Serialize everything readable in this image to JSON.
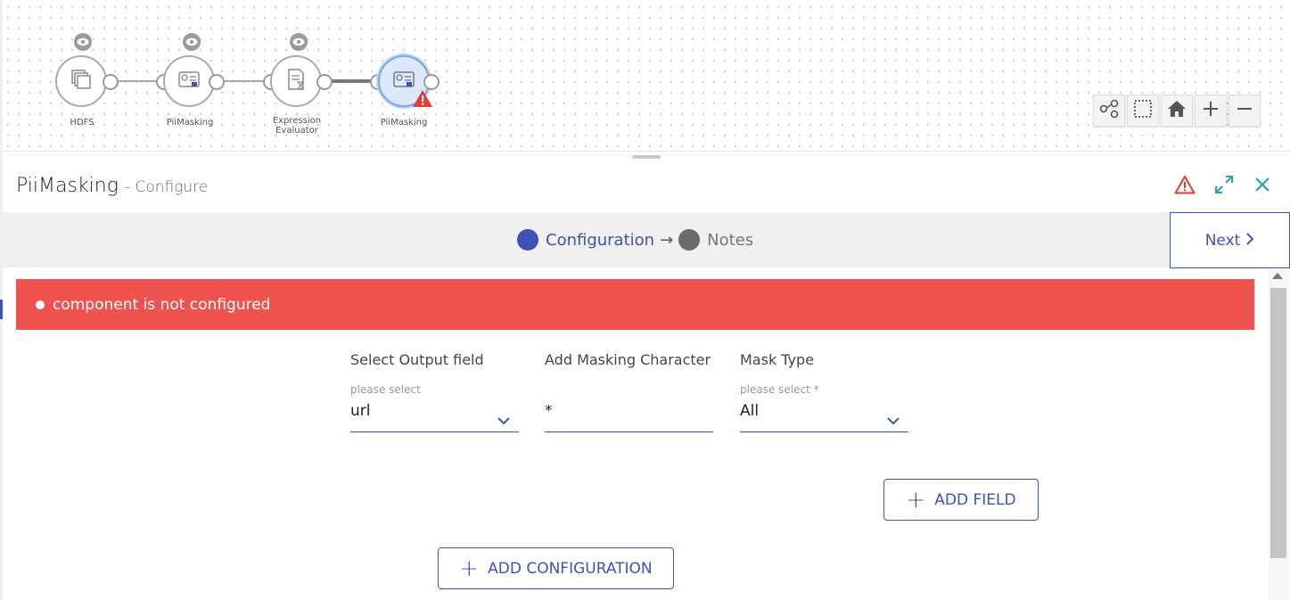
{
  "pipeline": {
    "nodes": [
      {
        "label": "HDFS",
        "icon": "hdfs-icon"
      },
      {
        "label": "PiiMasking",
        "icon": "pii-masking-icon"
      },
      {
        "label": "Expression Evaluator",
        "icon": "expression-evaluator-icon"
      },
      {
        "label": "PiiMasking",
        "icon": "pii-masking-icon",
        "active": true,
        "warning": true
      }
    ]
  },
  "canvas_toolbar": [
    "auto-layout-icon",
    "select-area-icon",
    "home-icon",
    "zoom-in-icon",
    "zoom-out-icon"
  ],
  "panel": {
    "title": "PiiMasking",
    "subtitle": "- Configure"
  },
  "steps": {
    "current": "Configuration",
    "arrow": "→",
    "next": "Notes",
    "current_color": "#3f51b5",
    "next_color": "#6b6b6b"
  },
  "next_button": {
    "label": "Next"
  },
  "error": {
    "message": "component is not configured",
    "color": "#ef5350"
  },
  "fields": {
    "output": {
      "label": "Select Output field",
      "hint": "please select",
      "value": "url"
    },
    "masking": {
      "label": "Add Masking Character",
      "value": "*"
    },
    "mask_type": {
      "label": "Mask Type",
      "hint": "please select *",
      "value": "All"
    }
  },
  "buttons": {
    "add_field": "ADD FIELD",
    "add_configuration": "ADD CONFIGURATION"
  },
  "colors": {
    "accent": "#3f51b5",
    "warning": "#e53935",
    "teal": "#26a69a"
  }
}
